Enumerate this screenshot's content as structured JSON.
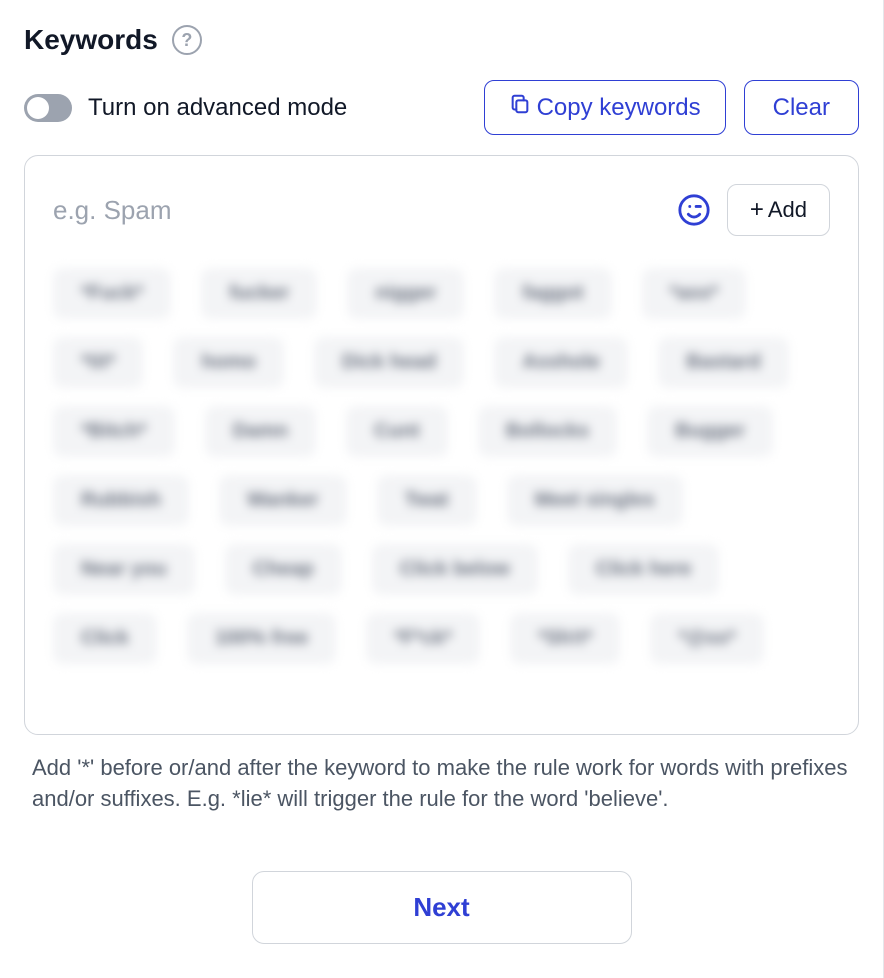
{
  "header": {
    "title": "Keywords",
    "help_symbol": "?"
  },
  "toggle": {
    "label": "Turn on advanced mode",
    "on": false
  },
  "buttons": {
    "copy_label": "Copy keywords",
    "clear_label": "Clear",
    "add_label": "Add",
    "next_label": "Next"
  },
  "input": {
    "placeholder": "e.g. Spam",
    "value": ""
  },
  "chips": [
    "*Fuck*",
    "fucker",
    "nigger",
    "faggot",
    "*ass*",
    "*tit*",
    "homo",
    "Dick head",
    "Asshole",
    "Bastard",
    "*Bitch*",
    "Damn",
    "Cunt",
    "Bollocks",
    "Bugger",
    "Rubbish",
    "Wanker",
    "Twat",
    "Meet singles",
    "Near you",
    "Cheap",
    "Click below",
    "Click here",
    "Click",
    "100% free",
    "*F*ck*",
    "*Sh!t*",
    "*@ss*"
  ],
  "hint": "Add '*' before or/and after the keyword to make the rule work for words with prefixes and/or suffixes. E.g. *lie* will trigger the rule for the word 'believe'.",
  "colors": {
    "accent": "#2f3fd4",
    "chip_bg": "#f3f4f6",
    "border": "#d1d5db"
  }
}
